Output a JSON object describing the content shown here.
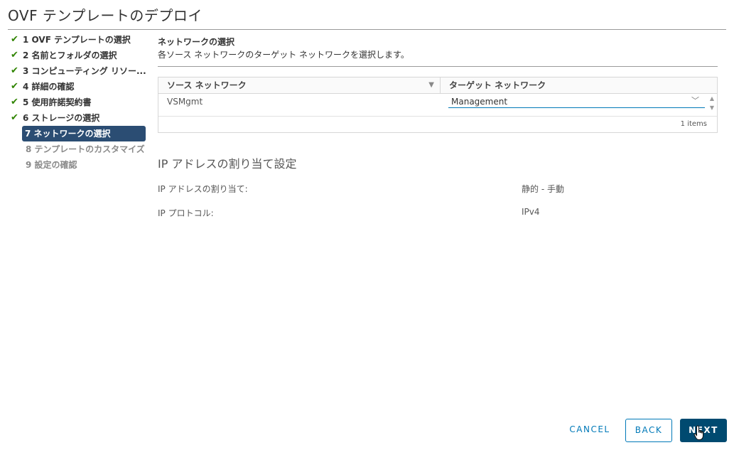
{
  "window": {
    "title": "OVF テンプレートのデプロイ"
  },
  "steps": [
    {
      "label": "1 OVF テンプレートの選択",
      "state": "done"
    },
    {
      "label": "2 名前とフォルダの選択",
      "state": "done"
    },
    {
      "label": "3 コンピューティング リソー...",
      "state": "done"
    },
    {
      "label": "4 詳細の確認",
      "state": "done"
    },
    {
      "label": "5 使用許諾契約書",
      "state": "done"
    },
    {
      "label": "6 ストレージの選択",
      "state": "done"
    },
    {
      "label": "7 ネットワークの選択",
      "state": "active"
    },
    {
      "label": "8 テンプレートのカスタマイズ",
      "state": "pending"
    },
    {
      "label": "9 設定の確認",
      "state": "pending"
    }
  ],
  "network": {
    "title": "ネットワークの選択",
    "description": "各ソース ネットワークのターゲット ネットワークを選択します。",
    "columns": {
      "source": "ソース ネットワーク",
      "target": "ターゲット ネットワーク"
    },
    "rows": [
      {
        "source": "VSMgmt",
        "target": "Management"
      }
    ],
    "footer": "1 items"
  },
  "ip": {
    "title": "IP アドレスの割り当て設定",
    "allocation_label": "IP アドレスの割り当て:",
    "allocation_value": "静的 - 手動",
    "protocol_label": "IP プロトコル:",
    "protocol_value": "IPv4"
  },
  "buttons": {
    "cancel": "CANCEL",
    "back": "BACK",
    "next": "NEXT"
  },
  "icons": {
    "check": "check-icon",
    "filter": "filter-icon",
    "chevron": "chevron-down-icon"
  },
  "colors": {
    "active_step": "#2b4d73",
    "done_check": "#2f8400",
    "primary": "#004a70",
    "link": "#0079b8"
  }
}
